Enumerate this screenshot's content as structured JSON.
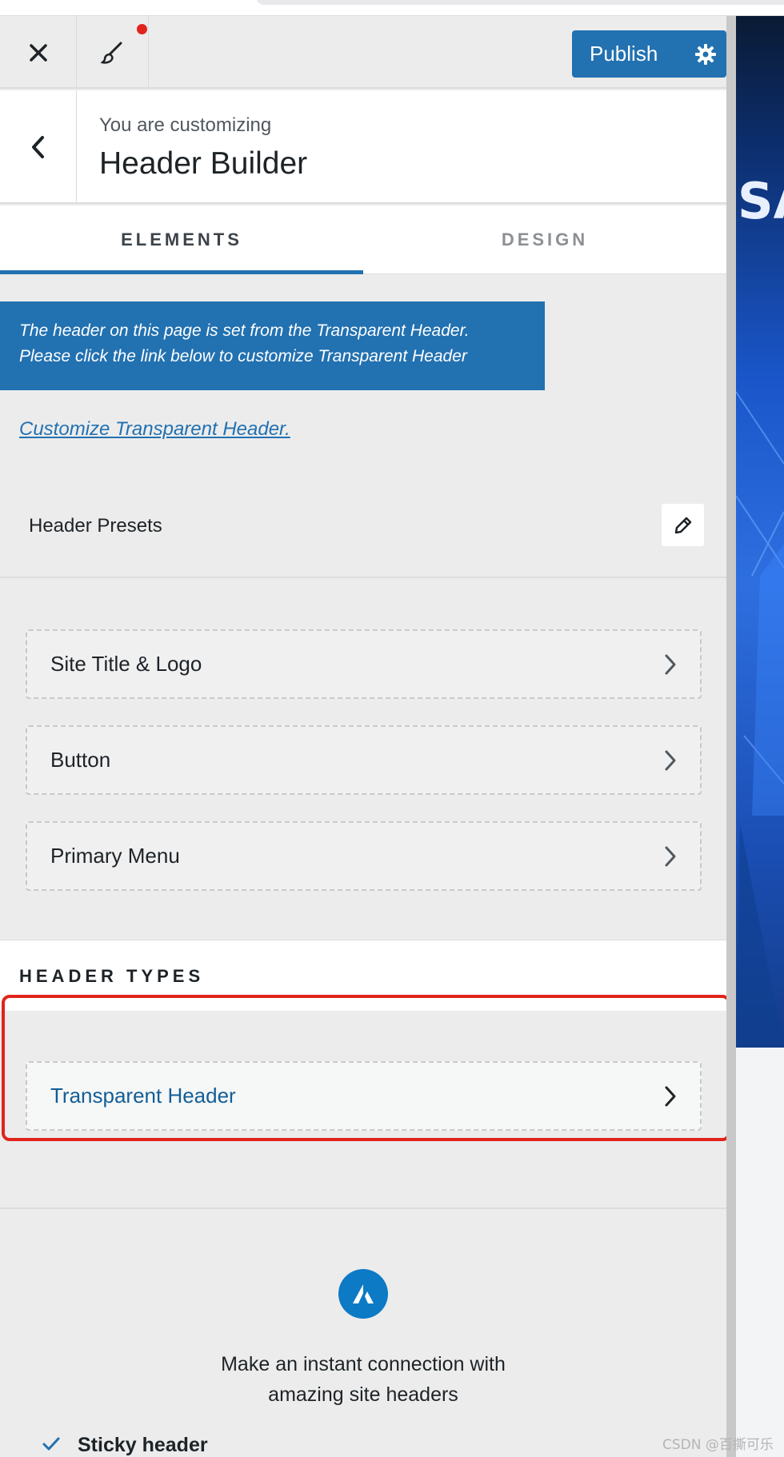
{
  "topbar": {
    "close_icon": "close-icon",
    "brush_icon": "paintbrush-icon",
    "publish_label": "Publish",
    "settings_icon": "gear-icon"
  },
  "header": {
    "subtitle": "You are customizing",
    "title": "Header Builder"
  },
  "tabs": [
    {
      "label": "ELEMENTS",
      "active": true
    },
    {
      "label": "DESIGN",
      "active": false
    }
  ],
  "notice": {
    "line1": "The header on this page is set from the Transparent Header.",
    "line2": "Please click the link below to customize Transparent Header"
  },
  "customize_link": "Customize Transparent Header.",
  "presets": {
    "label": "Header Presets",
    "edit_icon": "pencil-icon"
  },
  "elements": [
    {
      "label": "Site Title & Logo"
    },
    {
      "label": "Button"
    },
    {
      "label": "Primary Menu"
    }
  ],
  "header_types": {
    "heading": "HEADER TYPES",
    "items": [
      {
        "label": "Transparent Header"
      }
    ]
  },
  "promo": {
    "logo_icon": "astra-logo-icon",
    "line1": "Make an instant connection with",
    "line2": "amazing site headers",
    "features": [
      {
        "label": "Sticky header"
      }
    ]
  },
  "preview": {
    "visible_text": "SA"
  },
  "watermark": "CSDN @百撕可乐",
  "colors": {
    "accent": "#2271b1",
    "highlight": "#e0241b",
    "notification": "#e0241b"
  }
}
